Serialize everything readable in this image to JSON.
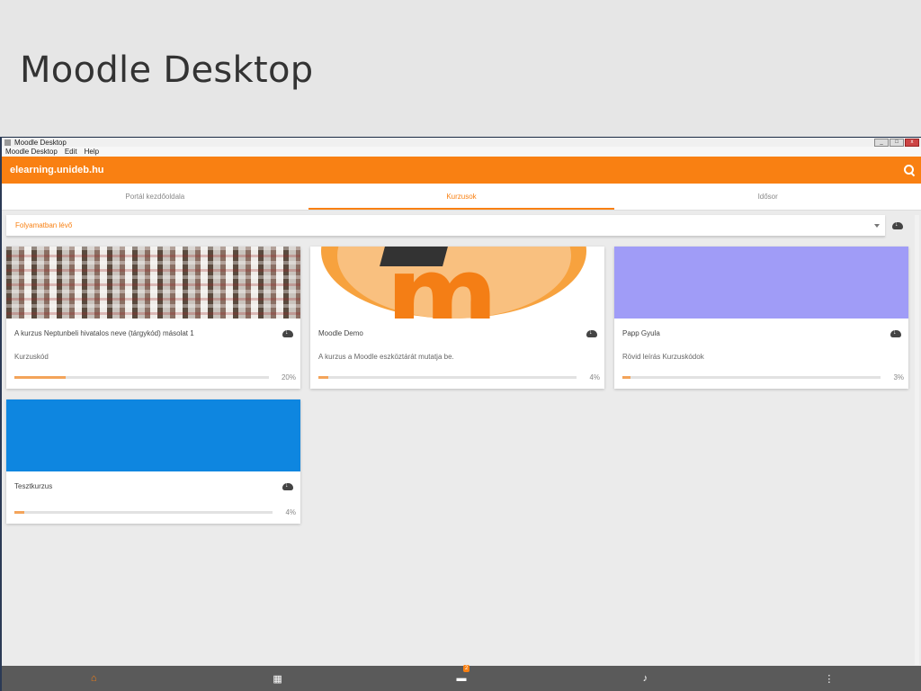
{
  "slide": {
    "title": "Moodle Desktop"
  },
  "window": {
    "title": "Moodle Desktop",
    "menu": [
      "Moodle Desktop",
      "Edit",
      "Help"
    ]
  },
  "app": {
    "site": "elearning.unideb.hu",
    "tabs": [
      "Portál kezdőoldala",
      "Kurzusok",
      "Idősor"
    ],
    "active_tab": "Kurzusok",
    "filter": {
      "value": "Folyamatban lévő"
    },
    "accent_color": "#f98012",
    "courses": [
      {
        "name": "A kurzus Neptunbeli hivatalos neve (tárgykód) másolat 1",
        "summary": "Kurzuskód",
        "progress": 20,
        "progress_label": "20%",
        "image": "exam-hall-photo"
      },
      {
        "name": "Moodle Demo",
        "summary": "A kurzus a Moodle eszköztárát mutatja be.",
        "progress": 4,
        "progress_label": "4%",
        "image": "moodle-logo"
      },
      {
        "name": "Papp Gyula",
        "summary": "Rövid leírás Kurzuskódok",
        "progress": 3,
        "progress_label": "3%",
        "image": "color-block",
        "color": "#a09cf7"
      },
      {
        "name": "Tesztkurzus",
        "summary": "",
        "progress": 4,
        "progress_label": "4%",
        "image": "color-block",
        "color": "#0e86e0"
      }
    ],
    "bottom_nav": {
      "messages_badge": "2",
      "icons": [
        "home-icon",
        "calendar-icon",
        "messages-icon",
        "bell-icon",
        "more-icon"
      ]
    }
  }
}
